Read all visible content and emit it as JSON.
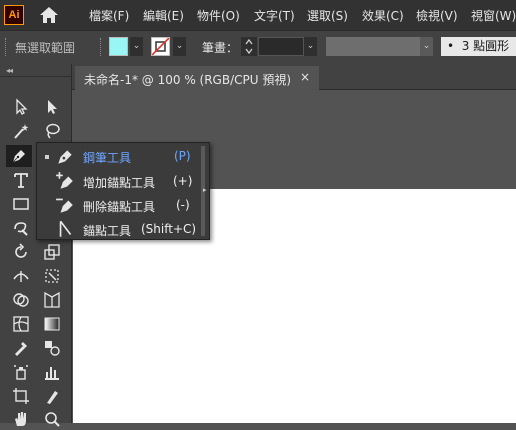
{
  "app": {
    "logo_text": "Ai"
  },
  "menu": [
    "檔案(F)",
    "編輯(E)",
    "物件(O)",
    "文字(T)",
    "選取(S)",
    "效果(C)",
    "檢視(V)",
    "視窗(W)"
  ],
  "control_bar": {
    "selection_label": "無選取範圍",
    "stroke_label": "筆畫：",
    "stroke_weight": "",
    "brush_label": "3 點圓形",
    "fill_color": "#9af5f5",
    "stroke_color": "#ffffff"
  },
  "document": {
    "tab_title": "未命名-1* @ 100 % (RGB/CPU 預視)",
    "close_label": "×"
  },
  "flyout": {
    "items": [
      {
        "label": "鋼筆工具",
        "shortcut": "(P)",
        "icon": "pen-icon",
        "active": true
      },
      {
        "label": "增加錨點工具",
        "shortcut": "(+)",
        "icon": "add-anchor-point-icon",
        "active": false
      },
      {
        "label": "刪除錨點工具",
        "shortcut": "(-)",
        "icon": "delete-anchor-point-icon",
        "active": false
      },
      {
        "label": "錨點工具",
        "shortcut": "(Shift+C)",
        "icon": "anchor-point-icon",
        "active": false
      }
    ]
  },
  "toolbar": {
    "tools": [
      "selection-tool-icon",
      "direct-selection-tool-icon",
      "magic-wand-tool-icon",
      "lasso-tool-icon",
      "pen-tool-icon",
      "curvature-tool-icon",
      "type-tool-icon",
      "line-segment-tool-icon",
      "rectangle-tool-icon",
      "paintbrush-tool-icon",
      "shaper-tool-icon",
      "eraser-tool-icon",
      "rotate-tool-icon",
      "scale-tool-icon",
      "width-tool-icon",
      "free-transform-tool-icon",
      "shape-builder-tool-icon",
      "perspective-grid-tool-icon",
      "mesh-tool-icon",
      "gradient-tool-icon",
      "eyedropper-tool-icon",
      "blend-tool-icon",
      "symbol-sprayer-tool-icon",
      "column-graph-tool-icon",
      "artboard-tool-icon",
      "slice-tool-icon",
      "hand-tool-icon",
      "zoom-tool-icon"
    ]
  },
  "colors": {
    "accent": "#6fa6ff",
    "ui_dark": "#323232",
    "panel": "#424242",
    "canvas": "#535353"
  }
}
